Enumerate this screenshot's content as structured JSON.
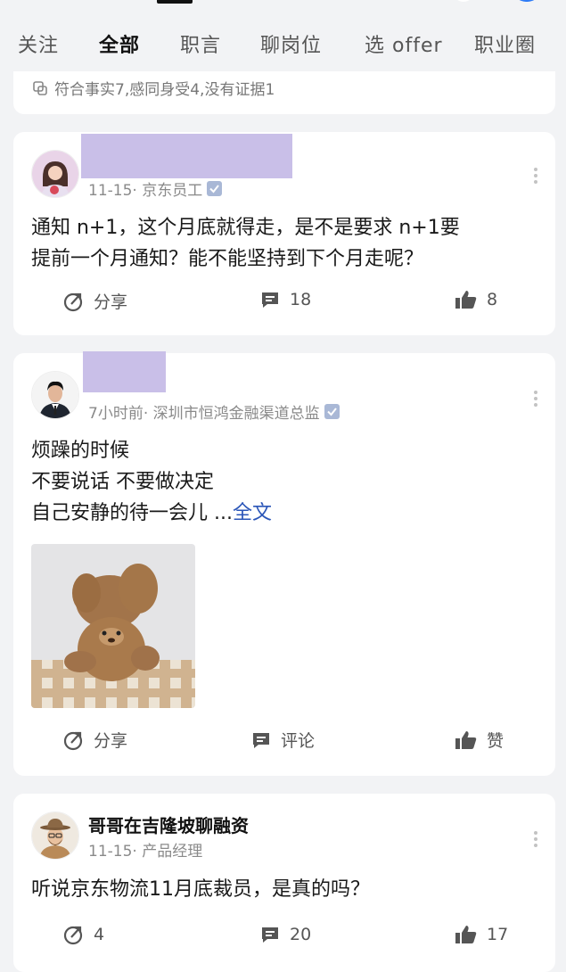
{
  "tabs": [
    "关注",
    "全部",
    "职言",
    "聊岗位",
    "选 offer",
    "职业圈"
  ],
  "active_tab_index": 1,
  "partial_card": {
    "stats_text": "符合事实7,感同身受4,没有证据1"
  },
  "posts": [
    {
      "author_name": "",
      "name_redacted": true,
      "meta": "11-15· 京东员工",
      "verified_badge": true,
      "content_lines": [
        "通知 n+1，这个月底就得走，是不是要求 n+1要",
        "提前一个月通知？能不能坚持到下个月走呢？"
      ],
      "share_label": "分享",
      "comment_count": "18",
      "like_count": "8"
    },
    {
      "author_name": "",
      "name_redacted": true,
      "meta": "7小时前· 深圳市恒鸿金融渠道总监",
      "verified_badge": true,
      "content_lines": [
        "烦躁的时候",
        "不要说话 不要做决定",
        "自己安静的待一会儿 ..."
      ],
      "full_text_link": "全文",
      "has_image": true,
      "share_label": "分享",
      "comment_label": "评论",
      "like_label": "赞"
    },
    {
      "author_name": "哥哥在吉隆坡聊融资",
      "meta": "11-15· 产品经理",
      "content_lines": [
        "听说京东物流11月底裁员，是真的吗？"
      ],
      "share_count": "4",
      "comment_count": "20",
      "like_count": "17"
    }
  ],
  "colors": {
    "background": "#f2f3f5",
    "card": "#ffffff",
    "redaction": "#c9bfe8",
    "link": "#2b56b8",
    "icon": "#555555"
  }
}
